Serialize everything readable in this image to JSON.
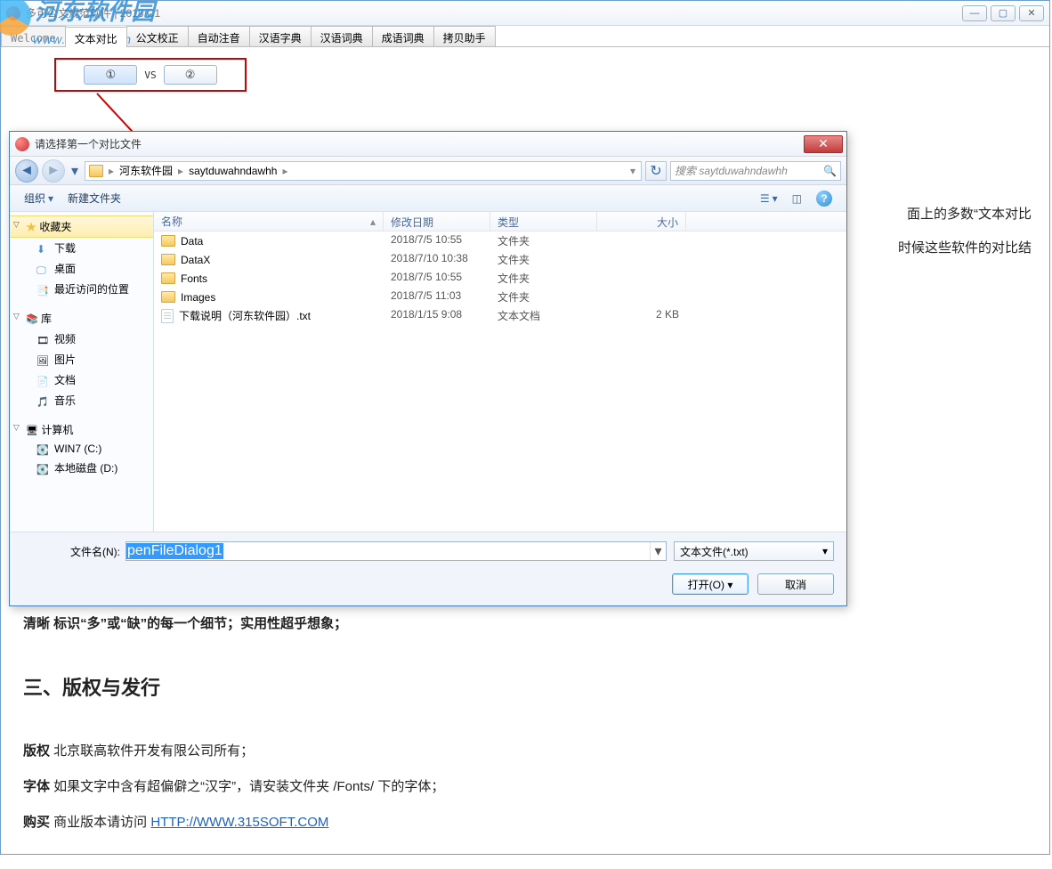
{
  "app": {
    "title": "多可公文规范软件 | 2018 C1",
    "watermark": {
      "text1": "河东软件园",
      "text2": "www.pc0359.cn"
    },
    "tabs": [
      "Welcome",
      "文本对比",
      "公文校正",
      "自动注音",
      "汉语字典",
      "汉语词典",
      "成语词典",
      "拷贝助手"
    ],
    "compare": {
      "btn1": "①",
      "vs": "VS",
      "btn2": "②"
    }
  },
  "body": {
    "line_r1": "面上的多数“文本对比",
    "line_r2": "时候这些软件的对比结",
    "line1": "清晰 标识“多”或“缺”的每一个细节；实用性超乎想象；",
    "heading": "三、版权与发行",
    "p1a": "版权",
    "p1b": " 北京联高软件开发有限公司所有；",
    "p2a": "字体",
    "p2b": " 如果文字中含有超偏僻之“汉字”，请安装文件夹 /Fonts/ 下的字体；",
    "p3a": "购买",
    "p3b": " 商业版本请访问 ",
    "p3link": "HTTP://WWW.315SOFT.COM"
  },
  "dialog": {
    "title": "请选择第一个对比文件",
    "breadcrumb": [
      "河东软件园",
      "saytduwahndawhh"
    ],
    "search_placeholder": "搜索 saytduwahndawhh",
    "toolbar": {
      "organize": "组织",
      "newfolder": "新建文件夹"
    },
    "sidebar": {
      "favorites": {
        "head": "收藏夹",
        "items": [
          "下载",
          "桌面",
          "最近访问的位置"
        ]
      },
      "libraries": {
        "head": "库",
        "items": [
          "视频",
          "图片",
          "文档",
          "音乐"
        ]
      },
      "computer": {
        "head": "计算机",
        "items": [
          "WIN7 (C:)",
          "本地磁盘 (D:)"
        ]
      }
    },
    "columns": {
      "name": "名称",
      "date": "修改日期",
      "type": "类型",
      "size": "大小"
    },
    "rows": [
      {
        "icon": "folder",
        "name": "Data",
        "date": "2018/7/5 10:55",
        "type": "文件夹",
        "size": ""
      },
      {
        "icon": "folder",
        "name": "DataX",
        "date": "2018/7/10 10:38",
        "type": "文件夹",
        "size": ""
      },
      {
        "icon": "folder",
        "name": "Fonts",
        "date": "2018/7/5 10:55",
        "type": "文件夹",
        "size": ""
      },
      {
        "icon": "folder",
        "name": "Images",
        "date": "2018/7/5 11:03",
        "type": "文件夹",
        "size": ""
      },
      {
        "icon": "txt",
        "name": "下载说明（河东软件园）.txt",
        "date": "2018/1/15 9:08",
        "type": "文本文档",
        "size": "2 KB"
      }
    ],
    "filename_label": "文件名(N):",
    "filename_value": "penFileDialog1",
    "filter": "文本文件(*.txt)",
    "open": "打开(O)",
    "cancel": "取消"
  }
}
